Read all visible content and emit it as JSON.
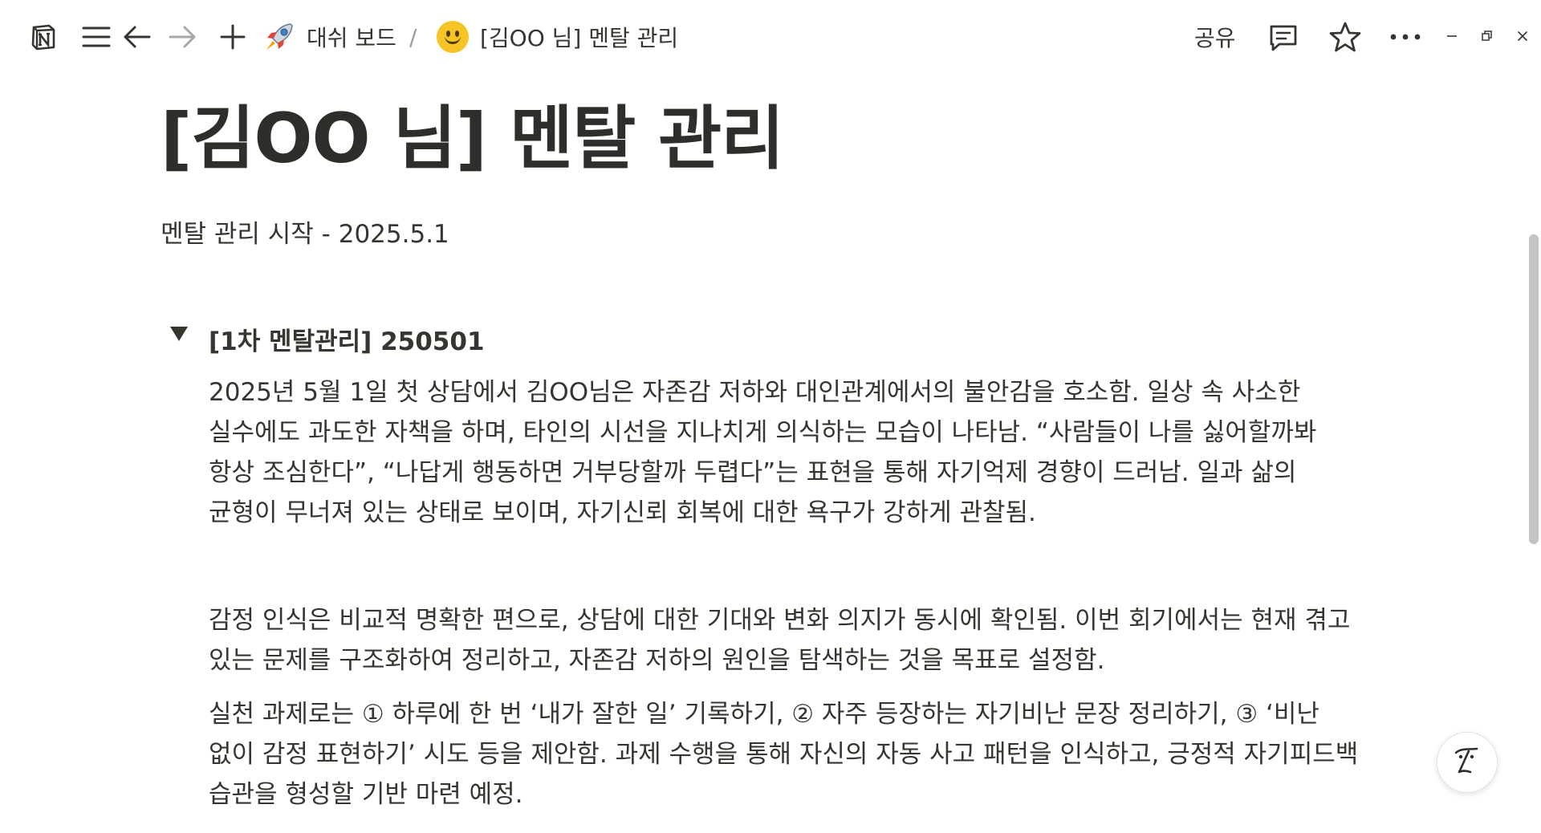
{
  "topbar": {
    "breadcrumb": [
      {
        "label": "대쉬 보드",
        "icon": "rocket-emoji"
      },
      {
        "label": "[김OO 님] 멘탈 관리",
        "icon": "smiling-face-emoji"
      }
    ],
    "separator": "/",
    "share_label": "공유",
    "icons": [
      "notion-logo-icon",
      "menu-icon",
      "back-arrow-icon",
      "forward-arrow-icon",
      "plus-icon",
      "comment-icon",
      "star-icon",
      "more-icon",
      "minimize-icon",
      "restore-icon",
      "close-icon"
    ]
  },
  "page": {
    "title": "[김OO 님] 멘탈 관리",
    "subtitle": "멘탈 관리 시작 - 2025.5.1"
  },
  "toggle": {
    "heading": "[1차 멘탈관리] 250501",
    "expanded": true,
    "paragraphs": [
      "2025년 5월 1일 첫 상담에서 김OO님은 자존감 저하와 대인관계에서의 불안감을 호소함. 일상 속 사소한 실수에도 과도한 자책을 하며, 타인의 시선을 지나치게 의식하는 모습이 나타남. “사람들이 나를 싫어할까봐 항상 조심한다”, “나답게 행동하면 거부당할까 두렵다”는 표현을 통해 자기억제 경향이 드러남. 일과 삶의 균형이 무너져 있는 상태로 보이며, 자기신뢰 회복에 대한 욕구가 강하게 관찰됨.",
      "감정 인식은 비교적 명확한 편으로, 상담에 대한 기대와 변화 의지가 동시에 확인됨. 이번 회기에서는 현재 겪고 있는 문제를 구조화하여 정리하고, 자존감 저하의 원인을 탐색하는 것을 목표로 설정함.",
      "실천 과제로는 ① 하루에 한 번 ‘내가 잘한 일’ 기록하기, ② 자주 등장하는 자기비난 문장 정리하기, ③ ‘비난 없이 감정 표현하기’ 시도 등을 제안함. 과제 수행을 통해 자신의 자동 사고 패턴을 인식하고, 긍정적 자기피드백 습관을 형성할 기반 마련 예정."
    ]
  },
  "ai_button": {
    "icon": "notion-ai-icon"
  },
  "colors": {
    "text": "#37352f",
    "muted": "#9b9a97",
    "scrollbar": "#c4c4c4"
  }
}
